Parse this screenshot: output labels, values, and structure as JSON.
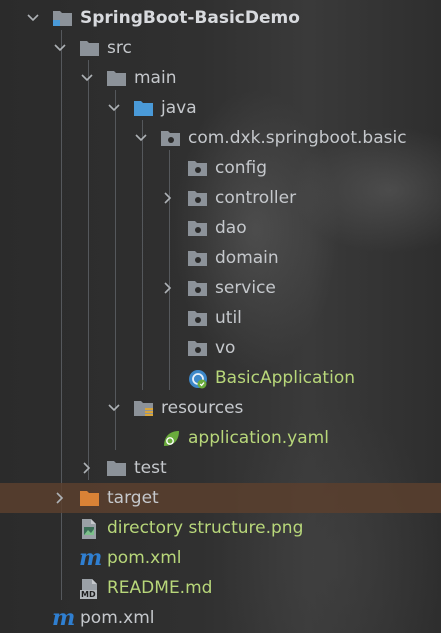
{
  "tree": {
    "root_label": "SpringBoot-BasicDemo",
    "src_label": "src",
    "main_label": "main",
    "java_label": "java",
    "package_label": "com.dxk.springboot.basic",
    "config_label": "config",
    "controller_label": "controller",
    "dao_label": "dao",
    "domain_label": "domain",
    "service_label": "service",
    "util_label": "util",
    "vo_label": "vo",
    "basic_app_label": "BasicApplication",
    "resources_label": "resources",
    "app_yaml_label": "application.yaml",
    "test_label": "test",
    "target_label": "target",
    "directory_png_label": "directory structure.png",
    "inner_pom_label": "pom.xml",
    "readme_label": "README.md",
    "outer_pom_label": "pom.xml"
  },
  "icons": {
    "maven_glyph": "m",
    "md_badge": "MD"
  },
  "colors": {
    "folder": "#8c9299",
    "java_folder": "#4a9ad8",
    "target_folder": "#d98236",
    "label_default": "#c5c8cc",
    "label_green": "#b8d77a",
    "selection_bg": "#5a402e",
    "maven": "#2f7fd1",
    "spring": "#6aab3c"
  }
}
